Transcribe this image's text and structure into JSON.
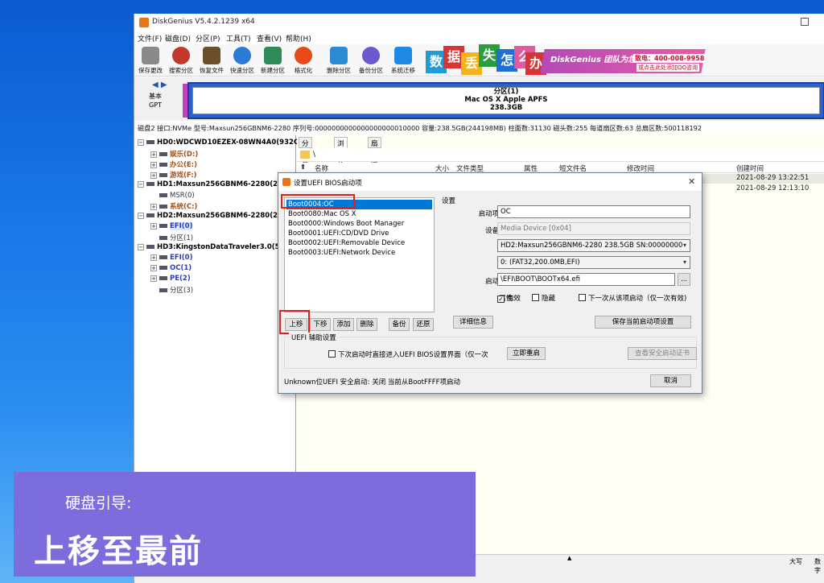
{
  "window": {
    "title": "DiskGenius V5.4.2.1239 x64"
  },
  "menu": [
    "文件(F)",
    "磁盘(D)",
    "分区(P)",
    "工具(T)",
    "查看(V)",
    "帮助(H)"
  ],
  "toolbar": [
    {
      "label": "保存更改",
      "icon": "save-icon",
      "color": "#8a8a8a"
    },
    {
      "label": "搜索分区",
      "icon": "search-icon",
      "color": "#c0392b"
    },
    {
      "label": "恢复文件",
      "icon": "recover-icon",
      "color": "#6b4f2a"
    },
    {
      "label": "快速分区",
      "icon": "quick-partition-icon",
      "color": "#2a7bd4"
    },
    {
      "label": "新建分区",
      "icon": "new-partition-icon",
      "color": "#2e8b57"
    },
    {
      "label": "格式化",
      "icon": "format-icon",
      "color": "#e64a19"
    },
    {
      "label": "删除分区",
      "icon": "delete-icon",
      "color": "#2a8bd4"
    },
    {
      "label": "备份分区",
      "icon": "backup-icon",
      "color": "#6a5acd"
    },
    {
      "label": "系统迁移",
      "icon": "migrate-icon",
      "color": "#1e88e5"
    }
  ],
  "banner": {
    "tiles": [
      {
        "char": "数",
        "color": "#1f9bd6"
      },
      {
        "char": "据",
        "color": "#d93434"
      },
      {
        "char": "丢",
        "color": "#f2b31b"
      },
      {
        "char": "失",
        "color": "#2a9d3e"
      },
      {
        "char": "怎",
        "color": "#1f6fd6"
      },
      {
        "char": "么",
        "color": "#e05aa0"
      },
      {
        "char": "办",
        "color": "#d93434"
      }
    ],
    "brand": "DiskGenius 团队为您服务",
    "phone": "致电：400-008-9958",
    "qq": "或点击此处添加QQ咨询"
  },
  "disk_map": {
    "type": "基本",
    "scheme": "GPT",
    "partition_name": "分区(1)",
    "partition_fs": "Mac OS X Apple APFS",
    "partition_size": "238.3GB"
  },
  "disk_info": "磁盘2 接口:NVMe  型号:Maxsun256GBNM6-2280  序列号:0000000000000000000010000  容量:238.5GB(244198MB)  柱面数:31130  磁头数:255  每道扇区数:63  总扇区数:500118192",
  "tree": [
    {
      "text": "HD0:WDCWD10EZEX-08WN4A0(932G",
      "kind": "hd",
      "indent": 0
    },
    {
      "text": "娱乐(D:)",
      "kind": "pt",
      "indent": 1
    },
    {
      "text": "办公(E:)",
      "kind": "pt",
      "indent": 1
    },
    {
      "text": "游戏(F:)",
      "kind": "pt",
      "indent": 1
    },
    {
      "text": "HD1:Maxsun256GBNM6-2280(238",
      "kind": "hd",
      "indent": 0
    },
    {
      "text": "MSR(0)",
      "kind": "px",
      "indent": 1
    },
    {
      "text": "系统(C:)",
      "kind": "pt",
      "indent": 1
    },
    {
      "text": "HD2:Maxsun256GBNM6-2280(238",
      "kind": "hd",
      "indent": 0
    },
    {
      "text": "EFI(0)",
      "kind": "pb",
      "indent": 1
    },
    {
      "text": "分区(1)",
      "kind": "px",
      "indent": 1
    },
    {
      "text": "HD3:KingstonDataTraveler3.0(58G",
      "kind": "hd",
      "indent": 0
    },
    {
      "text": "EFI(0)",
      "kind": "pb",
      "indent": 1
    },
    {
      "text": "OC(1)",
      "kind": "pb",
      "indent": 1
    },
    {
      "text": "PE(2)",
      "kind": "pb",
      "indent": 1
    },
    {
      "text": "分区(3)",
      "kind": "px",
      "indent": 1
    }
  ],
  "tabs": [
    "分区参数",
    "浏览文件",
    "扇区编辑"
  ],
  "path": "\\",
  "columns": [
    "名称",
    "大小",
    "文件类型",
    "属性",
    "短文件名",
    "修改时间",
    "创建时间"
  ],
  "rows": [
    {
      "created": "2021-08-29 13:22:51"
    },
    {
      "created": "2021-08-29 12:13:10"
    }
  ],
  "status": {
    "caps": "大写",
    "num": "数字"
  },
  "dialog": {
    "title": "设置UEFI BIOS启动项",
    "boot_items": [
      "Boot0004:OC",
      "Boot0080:Mac OS X",
      "Boot0000:Windows Boot Manager",
      "Boot0001:UEFI:CD/DVD Drive",
      "Boot0002:UEFI:Removable Device",
      "Boot0003:UEFI:Network Device"
    ],
    "list_buttons": [
      "上移",
      "下移",
      "添加",
      "删除",
      "备份",
      "还原"
    ],
    "settings_label": "设置",
    "name_label": "启动项名称:",
    "name_value": "OC",
    "type_label": "设备类型:",
    "type_value": "Media Device [0x04]",
    "disk_label": "磁盘:",
    "disk_value": "HD2:Maxsun256GBNM6-2280 238.5GB SN:00000000",
    "part_label": "分区:",
    "part_value": "0: (FAT32,200.0MB,EFI)",
    "file_label": "启动文件:",
    "file_value": "\\EFI\\BOOT\\BOOTx64.efi",
    "browse": "...",
    "attr_label": "属性:",
    "attr_valid": "有效",
    "attr_hidden": "隐藏",
    "attr_once": "下一次从该项启动（仅一次有效)",
    "detail_button": "详细信息",
    "save_button": "保存当前启动项设置",
    "uefi_group": "UEFI 辅助设置",
    "uefi_next": "下次启动时直接进入UEFI BIOS设置界面（仅一次",
    "restart_button": "立即重启",
    "cert_button": "查看安全启动证书",
    "footer": "Unknown位UEFI  安全启动: 关闭  当前从BootFFFF项启动",
    "cancel_button": "取消"
  },
  "caption": {
    "subtitle": "硬盘引导:",
    "title": "上移至最前"
  }
}
